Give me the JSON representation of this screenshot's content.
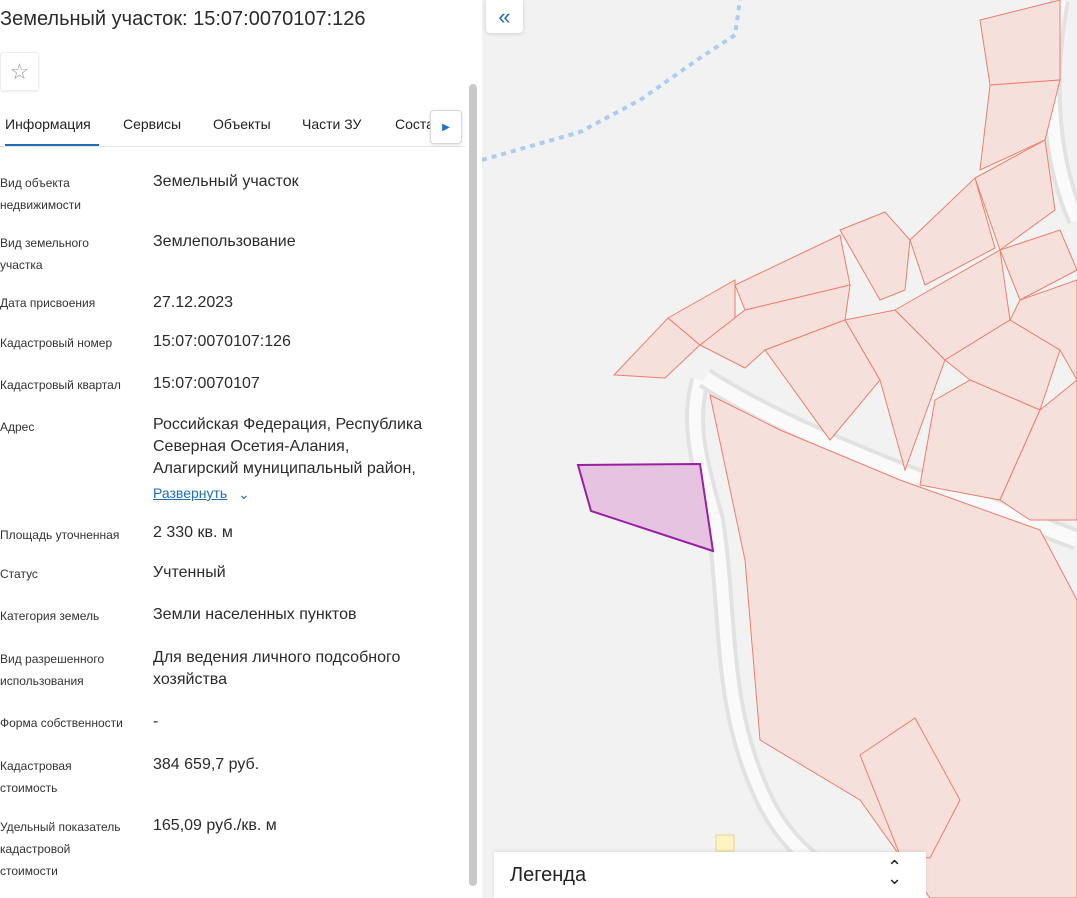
{
  "panel": {
    "title": "Земельный участок: 15:07:0070107:126",
    "favorite_icon": "☆",
    "tabs": [
      "Информация",
      "Сервисы",
      "Объекты",
      "Части ЗУ",
      "Соста"
    ],
    "tabs_next_icon": "▶",
    "rows": [
      {
        "label": "Вид объекта\nнедвижимости",
        "value": "Земельный участок"
      },
      {
        "label": "Вид земельного\nучастка",
        "value": "Землепользование"
      },
      {
        "label": "Дата присвоения",
        "value": "27.12.2023"
      },
      {
        "label": "Кадастровый номер",
        "value": "15:07:0070107:126"
      },
      {
        "label": "Кадастровый квартал",
        "value": "15:07:0070107"
      },
      {
        "label": "Адрес",
        "value": "Российская Федерация, Республика\nСеверная Осетия-Алания,\nАлагирский муниципальный район,"
      },
      {
        "label": "Площадь уточненная",
        "value": "2 330 кв. м"
      },
      {
        "label": "Статус",
        "value": "Учтенный"
      },
      {
        "label": "Категория земель",
        "value": "Земли населенных пунктов"
      },
      {
        "label": "Вид разрешенного\nиспользования",
        "value": "Для ведения личного подсобного\nхозяйства"
      },
      {
        "label": "Форма собственности",
        "value": "-"
      },
      {
        "label": "Кадастровая\nстоимость",
        "value": "384 659,7 руб."
      },
      {
        "label": "Удельный показатель\nкадастровой\nстоимости",
        "value": "165,09 руб./кв. м"
      }
    ],
    "expand_label": "Развернуть",
    "expand_icon": "⌄"
  },
  "map": {
    "collapse_icon": "«",
    "legend_title": "Легенда",
    "legend_toggle_icon": "⌃⌄"
  }
}
